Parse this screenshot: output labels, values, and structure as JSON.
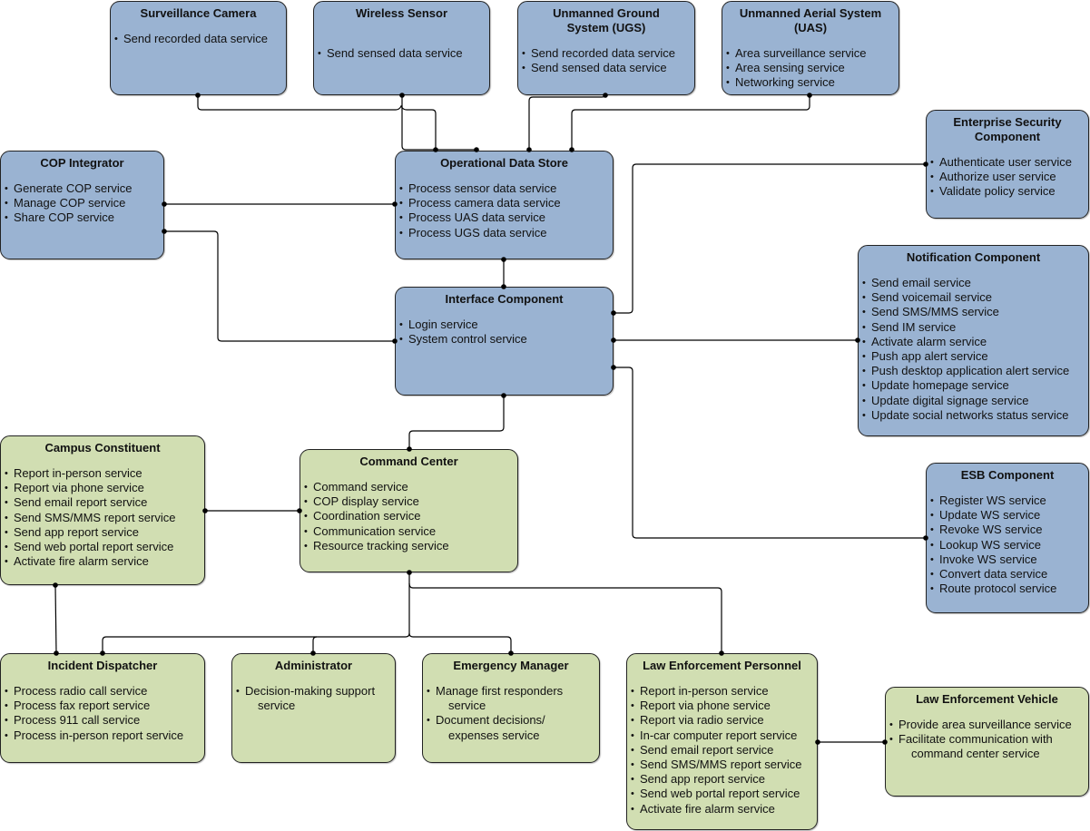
{
  "colors": {
    "blue_fill": "#9ab3d2",
    "green_fill": "#d1deb2",
    "line": "#000000"
  },
  "components": {
    "surveillance_camera": {
      "title": "Surveillance Camera",
      "services": [
        "Send recorded data service"
      ]
    },
    "wireless_sensor": {
      "title": "Wireless Sensor",
      "services": [
        "Send sensed data service"
      ]
    },
    "ugs": {
      "title": "Unmanned Ground System (UGS)",
      "services": [
        "Send recorded data service",
        "Send sensed data service"
      ]
    },
    "uas": {
      "title": "Unmanned Aerial System (UAS)",
      "services": [
        "Area surveillance service",
        "Area sensing service",
        "Networking service"
      ]
    },
    "cop_integrator": {
      "title": "COP Integrator",
      "services": [
        "Generate COP service",
        "Manage COP service",
        "Share COP service"
      ]
    },
    "operational_data_store": {
      "title": "Operational Data Store",
      "services": [
        "Process sensor data service",
        "Process camera data service",
        "Process UAS data service",
        "Process UGS data service"
      ]
    },
    "enterprise_security": {
      "title": "Enterprise Security Component",
      "services": [
        "Authenticate user service",
        "Authorize user service",
        "Validate policy service"
      ]
    },
    "interface_component": {
      "title": "Interface Component",
      "services": [
        "Login service",
        "System control service"
      ]
    },
    "notification_component": {
      "title": "Notification Component",
      "services": [
        "Send email service",
        "Send voicemail service",
        "Send SMS/MMS service",
        "Send IM service",
        "Activate alarm service",
        "Push app alert service",
        "Push desktop application alert service",
        "Update homepage service",
        "Update digital signage service",
        "Update social networks status service"
      ]
    },
    "esb_component": {
      "title": "ESB Component",
      "services": [
        "Register WS service",
        "Update WS service",
        "Revoke  WS service",
        "Lookup WS service",
        "Invoke WS service",
        "Convert data service",
        "Route protocol service"
      ]
    },
    "campus_constituent": {
      "title": "Campus Constituent",
      "services": [
        "Report in-person service",
        "Report via phone service",
        "Send email report service",
        "Send SMS/MMS report service",
        "Send app report service",
        "Send web portal report service",
        "Activate fire alarm service"
      ]
    },
    "command_center": {
      "title": "Command Center",
      "services": [
        "Command service",
        "COP display service",
        "Coordination service",
        "Communication service",
        "Resource tracking service"
      ]
    },
    "incident_dispatcher": {
      "title": "Incident Dispatcher",
      "services": [
        "Process radio call service",
        "Process fax report service",
        "Process 911 call service",
        "Process in-person report service"
      ]
    },
    "administrator": {
      "title": "Administrator",
      "services": [
        [
          "Decision-making support",
          "service"
        ]
      ]
    },
    "emergency_manager": {
      "title": "Emergency Manager",
      "services": [
        [
          "Manage first responders",
          "service"
        ],
        [
          "Document decisions/",
          "expenses service"
        ]
      ]
    },
    "law_enforcement_personnel": {
      "title": "Law Enforcement Personnel",
      "services": [
        "Report in-person service",
        "Report via phone service",
        "Report via radio service",
        "In-car computer report service",
        "Send email report service",
        "Send SMS/MMS report service",
        "Send app report service",
        "Send web portal report service",
        "Activate fire alarm service"
      ]
    },
    "law_enforcement_vehicle": {
      "title": "Law Enforcement Vehicle",
      "services": [
        "Provide area surveillance service",
        [
          "Facilitate communication with",
          "command center service"
        ]
      ]
    }
  },
  "connections": [
    [
      "surveillance_camera",
      "operational_data_store"
    ],
    [
      "wireless_sensor",
      "operational_data_store"
    ],
    [
      "ugs",
      "operational_data_store"
    ],
    [
      "uas",
      "operational_data_store"
    ],
    [
      "cop_integrator",
      "operational_data_store"
    ],
    [
      "cop_integrator",
      "interface_component"
    ],
    [
      "operational_data_store",
      "interface_component"
    ],
    [
      "interface_component",
      "enterprise_security"
    ],
    [
      "interface_component",
      "notification_component"
    ],
    [
      "interface_component",
      "esb_component"
    ],
    [
      "interface_component",
      "command_center"
    ],
    [
      "campus_constituent",
      "command_center"
    ],
    [
      "campus_constituent",
      "incident_dispatcher"
    ],
    [
      "command_center",
      "incident_dispatcher"
    ],
    [
      "command_center",
      "administrator"
    ],
    [
      "command_center",
      "emergency_manager"
    ],
    [
      "command_center",
      "law_enforcement_personnel"
    ],
    [
      "law_enforcement_personnel",
      "law_enforcement_vehicle"
    ]
  ]
}
